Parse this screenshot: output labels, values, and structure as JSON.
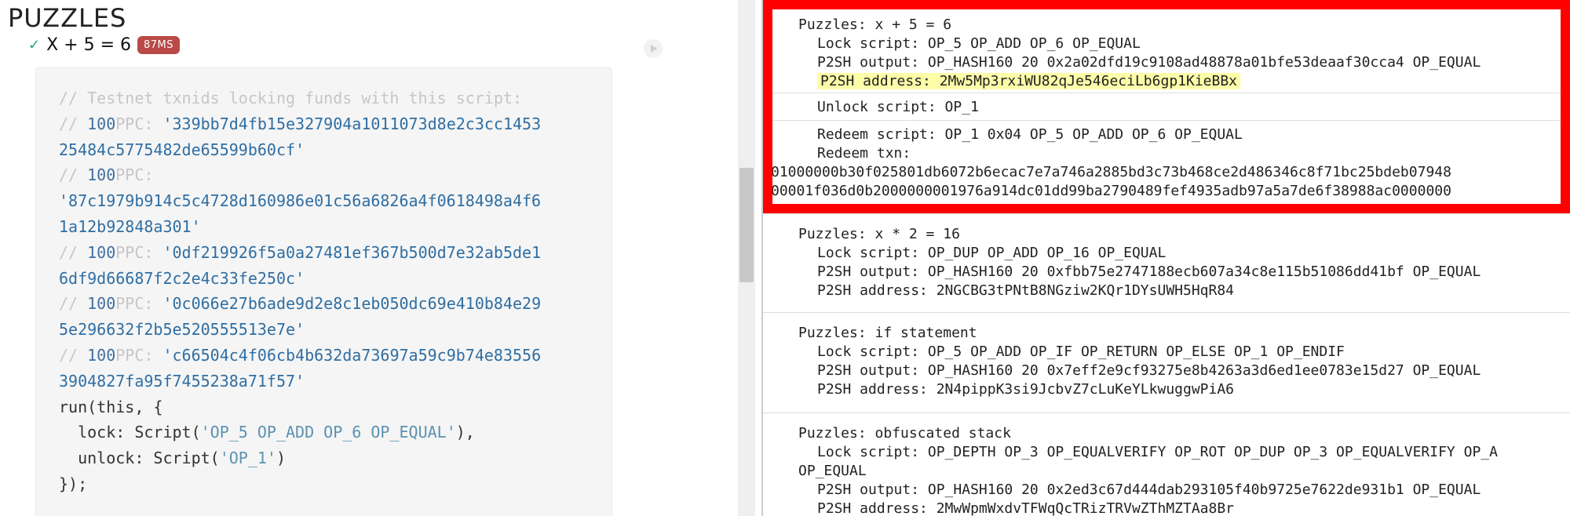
{
  "left": {
    "title": "PUZZLES",
    "test": {
      "check": "✓",
      "name": "X + 5 = 6",
      "time": "87MS"
    },
    "code": {
      "comment_header": "// Testnet txnids locking funds with this script:",
      "txs": [
        {
          "prefix": "// ",
          "amount": "100",
          "unit": "PPC:",
          "first": "'339bb7d4fb15e327904a1011073d8e2c3cc1453",
          "second": "25484c5775482de65599b60cf'",
          "same_line": true
        },
        {
          "prefix": "// ",
          "amount": "100",
          "unit": "PPC:",
          "first": "'87c1979b914c5c4728d160986e01c56a6826a4f0618498a4f6",
          "second": "1a12b92848a301'",
          "same_line": false
        },
        {
          "prefix": "// ",
          "amount": "100",
          "unit": "PPC:",
          "first": "'0df219926f5a0a27481ef367b500d7e32ab5de1",
          "second": "6df9d66687f2c2e4c33fe250c'",
          "same_line": true
        },
        {
          "prefix": "// ",
          "amount": "100",
          "unit": "PPC:",
          "first": "'0c066e27b6ade9d2e8c1eb050dc69e410b84e29",
          "second": "5e296632f2b5e520555513e7e'",
          "same_line": true
        },
        {
          "prefix": "// ",
          "amount": "100",
          "unit": "PPC:",
          "first": "'c66504c4f06cb4b632da73697a59c9b74e83556",
          "second": "3904827fa95f7455238a71f57'",
          "same_line": true
        }
      ],
      "run_open": "run(this, {",
      "lock_prefix": "  lock: Script(",
      "lock_value": "'OP_5 OP_ADD OP_6 OP_EQUAL'",
      "lock_suffix": "),",
      "unlock_prefix": "  unlock: Script(",
      "unlock_value": "'OP_1'",
      "unlock_suffix": ")",
      "run_close": "});"
    }
  },
  "right": {
    "block1": {
      "title": "Puzzles: x + 5 = 6",
      "lock": "Lock script: OP_5 OP_ADD OP_6 OP_EQUAL",
      "p2sh_output": "P2SH output: OP_HASH160 20 0x2a02dfd19c9108ad48878a01bfe53deaaf30cca4 OP_EQUAL",
      "p2sh_address": "P2SH address: 2Mw5Mp3rxiWU82qJe546eciLb6gp1KieBBx",
      "unlock": "Unlock script: OP_1",
      "redeem_script": "Redeem script: OP_1 0x04 OP_5 OP_ADD OP_6 OP_EQUAL",
      "redeem_txn_label": "Redeem txn:",
      "redeem_txn_1": "01000000b30f025801db6072b6ecac7e7a746a2885bd3c73b468ce2d486346c8f71bc25bdeb07948",
      "redeem_txn_2": "00001f036d0b2000000001976a914dc01dd99ba2790489fef4935adb97a5a7de6f38988ac0000000"
    },
    "block2": {
      "title": "Puzzles: x * 2 = 16",
      "lock": "Lock script: OP_DUP OP_ADD OP_16 OP_EQUAL",
      "p2sh_output": "P2SH output: OP_HASH160 20 0xfbb75e2747188ecb607a34c8e115b51086dd41bf OP_EQUAL",
      "p2sh_address": "P2SH address: 2NGCBG3tPNtB8NGziw2KQr1DYsUWH5HqR84"
    },
    "block3": {
      "title": "Puzzles: if statement",
      "lock": "Lock script: OP_5 OP_ADD OP_IF OP_RETURN OP_ELSE OP_1 OP_ENDIF",
      "p2sh_output": "P2SH output: OP_HASH160 20 0x7eff2e9cf93275e8b4263a3d6ed1ee0783e15d27 OP_EQUAL",
      "p2sh_address": "P2SH address: 2N4pippK3si9JcbvZ7cLuKeYLkwuggwPiA6"
    },
    "block4": {
      "title": "Puzzles: obfuscated stack",
      "lock": "Lock script: OP_DEPTH OP_3 OP_EQUALVERIFY OP_ROT OP_DUP OP_3 OP_EQUALVERIFY OP_A",
      "lock_wrap": "OP_EQUAL",
      "p2sh_output": "P2SH output: OP_HASH160 20 0x2ed3c67d444dab293105f40b9725e7622de931b1 OP_EQUAL",
      "p2sh_address": "P2SH address: 2MwWpmWxdvTFWqQcTRizTRVwZThMZTAa8Br"
    }
  },
  "colors": {
    "highlight_border": "#ff0000",
    "badge": "#b94a48",
    "check": "#27a38a",
    "address_highlight": "#fdfca9"
  }
}
